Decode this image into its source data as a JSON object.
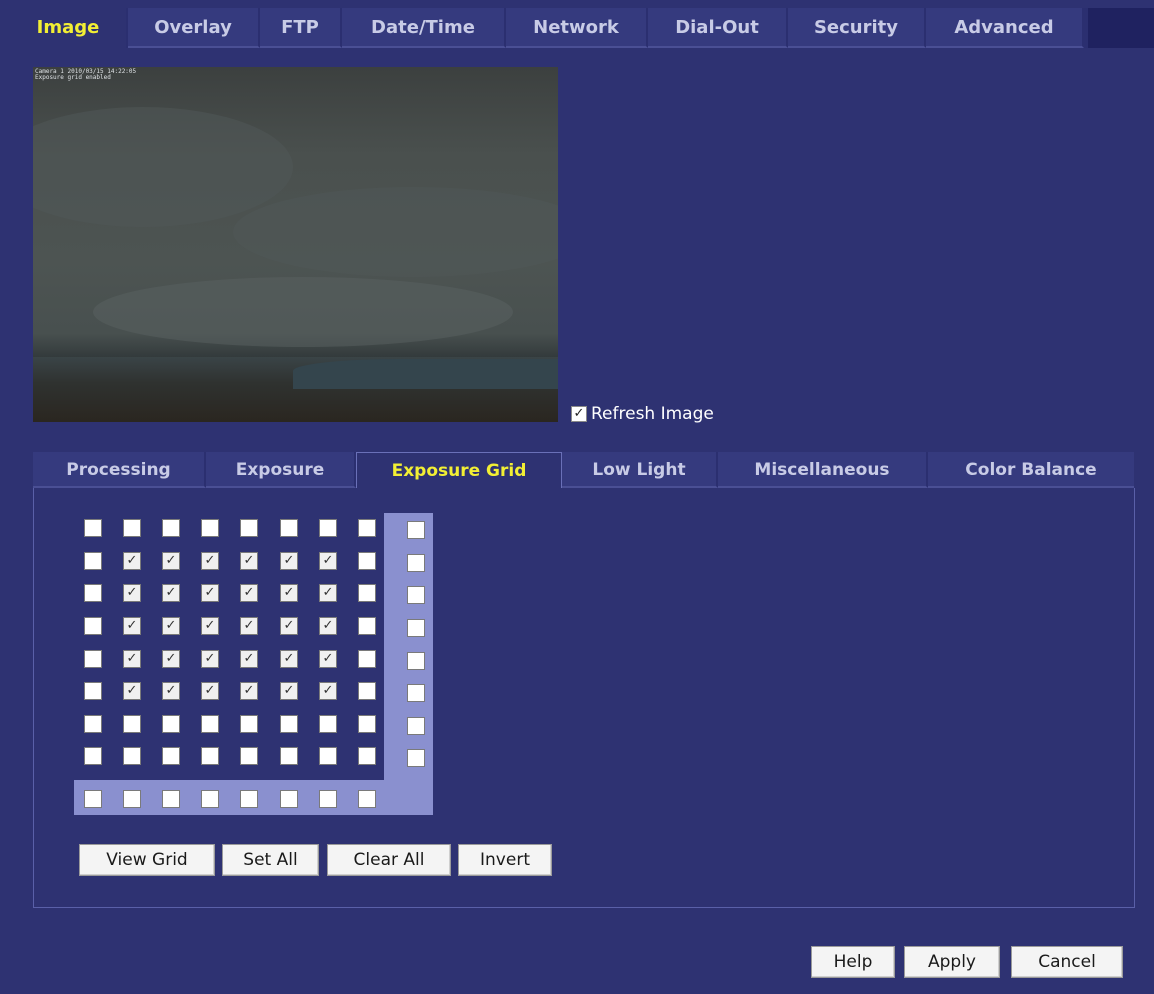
{
  "top_tabs": [
    "Image",
    "Overlay",
    "FTP",
    "Date/Time",
    "Network",
    "Dial-Out",
    "Security",
    "Advanced"
  ],
  "top_tab_active": "Image",
  "preview": {
    "stamp_line1": "Camera 1  2010/03/15 14:22:05",
    "stamp_line2": "Exposure grid enabled"
  },
  "refresh": {
    "label": "Refresh Image",
    "checked": true
  },
  "sub_tabs": [
    "Processing",
    "Exposure",
    "Exposure Grid",
    "Low Light",
    "Miscellaneous",
    "Color Balance"
  ],
  "sub_tab_active": "Exposure Grid",
  "grid": {
    "rows": 8,
    "cols": 8,
    "checked": [
      [
        0,
        0,
        0,
        0,
        0,
        0,
        0,
        0
      ],
      [
        0,
        1,
        1,
        1,
        1,
        1,
        1,
        0
      ],
      [
        0,
        1,
        1,
        1,
        1,
        1,
        1,
        0
      ],
      [
        0,
        1,
        1,
        1,
        1,
        1,
        1,
        0
      ],
      [
        0,
        1,
        1,
        1,
        1,
        1,
        1,
        0
      ],
      [
        0,
        1,
        1,
        1,
        1,
        1,
        1,
        0
      ],
      [
        0,
        0,
        0,
        0,
        0,
        0,
        0,
        0
      ],
      [
        0,
        0,
        0,
        0,
        0,
        0,
        0,
        0
      ]
    ],
    "row_toggles_checked": [
      0,
      0,
      0,
      0,
      0,
      0,
      0,
      0
    ],
    "col_toggles_checked": [
      0,
      0,
      0,
      0,
      0,
      0,
      0,
      0
    ]
  },
  "grid_buttons": {
    "view_grid": "View Grid",
    "set_all": "Set All",
    "clear_all": "Clear All",
    "invert": "Invert"
  },
  "footer_buttons": {
    "help": "Help",
    "apply": "Apply",
    "cancel": "Cancel"
  },
  "check_glyph": "✓",
  "colors": {
    "background": "#2e3272",
    "active_tab_text": "#f2ef34",
    "inactive_tab_text": "#c8cbe6",
    "grid_highlight": "#8a90cf"
  }
}
